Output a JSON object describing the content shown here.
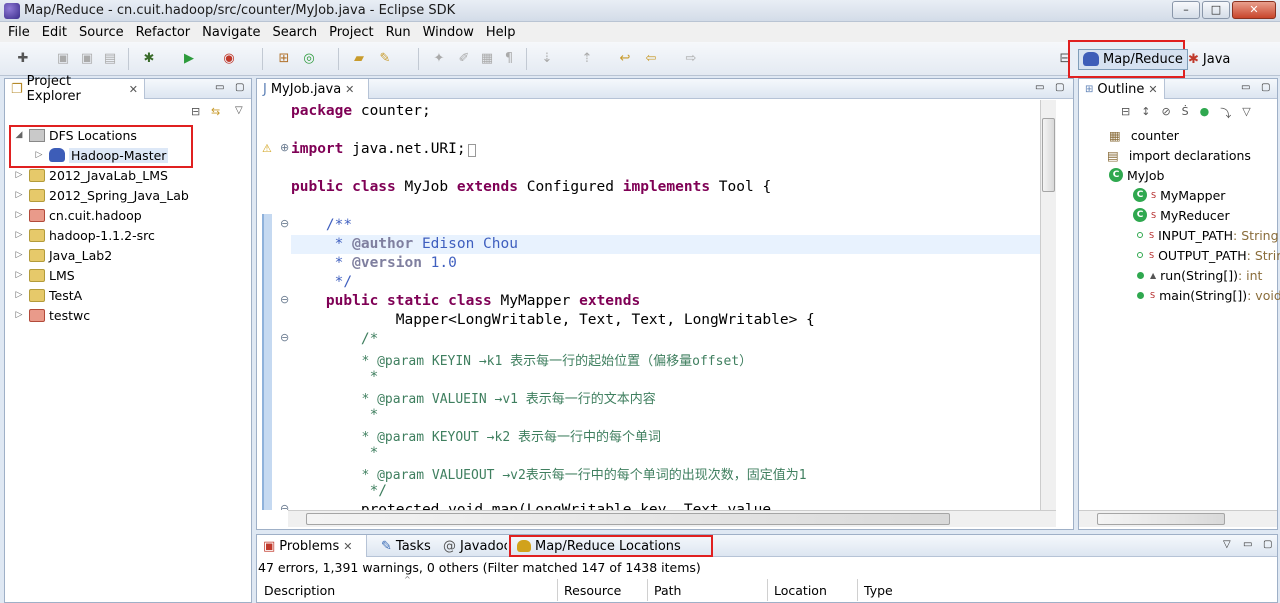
{
  "window": {
    "title": "Map/Reduce - cn.cuit.hadoop/src/counter/MyJob.java - Eclipse SDK",
    "minimize": "–",
    "maximize": "□",
    "close": "✕"
  },
  "menu": [
    "File",
    "Edit",
    "Source",
    "Refactor",
    "Navigate",
    "Search",
    "Project",
    "Run",
    "Window",
    "Help"
  ],
  "perspectives": {
    "mapreduce": "Map/Reduce",
    "java": "Java"
  },
  "project_explorer": {
    "title": "Project Explorer",
    "items": [
      {
        "label": "DFS Locations",
        "expanded": true
      },
      {
        "label": "Hadoop-Master"
      },
      {
        "label": "2012_JavaLab_LMS"
      },
      {
        "label": "2012_Spring_Java_Lab"
      },
      {
        "label": "cn.cuit.hadoop"
      },
      {
        "label": "hadoop-1.1.2-src"
      },
      {
        "label": "Java_Lab2"
      },
      {
        "label": "LMS"
      },
      {
        "label": "TestA"
      },
      {
        "label": "testwc"
      }
    ]
  },
  "editor": {
    "tab": "MyJob.java",
    "lines": {
      "l1_kw": "package",
      "l1_rest": " counter;",
      "l2_kw": "import",
      "l2_rest": " java.net.URI;",
      "l3_a": "public class",
      "l3_b": " MyJob ",
      "l3_c": "extends",
      "l3_d": " Configured ",
      "l3_e": "implements",
      "l3_f": " Tool {",
      "l4": "    /**",
      "l5_a": "     * ",
      "l5_tag": "@author",
      "l5_b": " Edison Chou",
      "l6_a": "     * ",
      "l6_tag": "@version",
      "l6_b": " 1.0",
      "l7": "     */",
      "l8_a": "    public static class",
      "l8_b": " MyMapper ",
      "l8_c": "extends",
      "l9": "            Mapper<LongWritable, Text, Text, LongWritable> {",
      "l10": "        /*",
      "l11": "         * @param KEYIN →k1 表示每一行的起始位置（偏移量offset）",
      "l12": "         *",
      "l13": "         * @param VALUEIN →v1 表示每一行的文本内容",
      "l14": "         *",
      "l15": "         * @param KEYOUT →k2 表示每一行中的每个单词",
      "l16": "         *",
      "l17": "         * @param VALUEOUT →v2表示每一行中的每个单词的出现次数，固定值为1",
      "l18": "         */",
      "l19": "        protected void map(LongWritable key, Text value,"
    }
  },
  "outline": {
    "title": "Outline",
    "items": [
      {
        "label": "counter"
      },
      {
        "label": "import declarations"
      },
      {
        "label": "MyJob"
      },
      {
        "label": "MyMapper"
      },
      {
        "label": "MyReducer"
      },
      {
        "label": "INPUT_PATH",
        "type": " : String"
      },
      {
        "label": "OUTPUT_PATH",
        "type": " : String"
      },
      {
        "label": "run(String[])",
        "type": " : int"
      },
      {
        "label": "main(String[])",
        "type": " : void"
      }
    ]
  },
  "bottom": {
    "tabs": [
      "Problems",
      "Tasks",
      "Javadoc",
      "Map/Reduce Locations"
    ],
    "status": "47 errors, 1,391 warnings, 0 others (Filter matched 147 of 1438 items)",
    "columns": [
      "Description",
      "Resource",
      "Path",
      "Location",
      "Type"
    ]
  },
  "colors": {
    "highlight": "#e02020",
    "keyword": "#7f0055",
    "javadoc": "#3f5fbf",
    "comment": "#3f7f5f"
  }
}
